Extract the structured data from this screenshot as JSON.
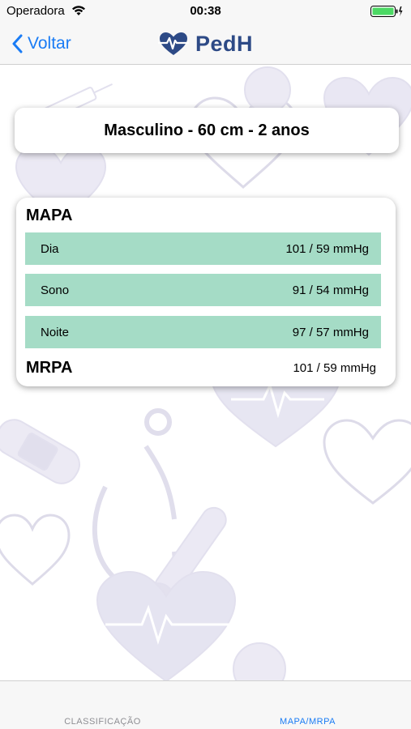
{
  "status_bar": {
    "carrier": "Operadora",
    "time": "00:38",
    "battery_color": "#4cd964"
  },
  "nav": {
    "back_label": "Voltar",
    "app_name": "PedH",
    "accent": "#1a7cf5",
    "brand_color": "#2d4a86"
  },
  "patient": {
    "summary": "Masculino - 60 cm - 2 anos"
  },
  "mapa": {
    "title": "MAPA",
    "rows": [
      {
        "label": "Dia",
        "value": "101 / 59 mmHg"
      },
      {
        "label": "Sono",
        "value": "91 / 54 mmHg"
      },
      {
        "label": "Noite",
        "value": "97 / 57 mmHg"
      }
    ],
    "row_color": "#a5dcc6"
  },
  "mrpa": {
    "title": "MRPA",
    "value": "101 / 59 mmHg"
  },
  "tabs": [
    {
      "label": "CLASSIFICAÇÃO",
      "active": false
    },
    {
      "label": "MAPA/MRPA",
      "active": true
    }
  ]
}
